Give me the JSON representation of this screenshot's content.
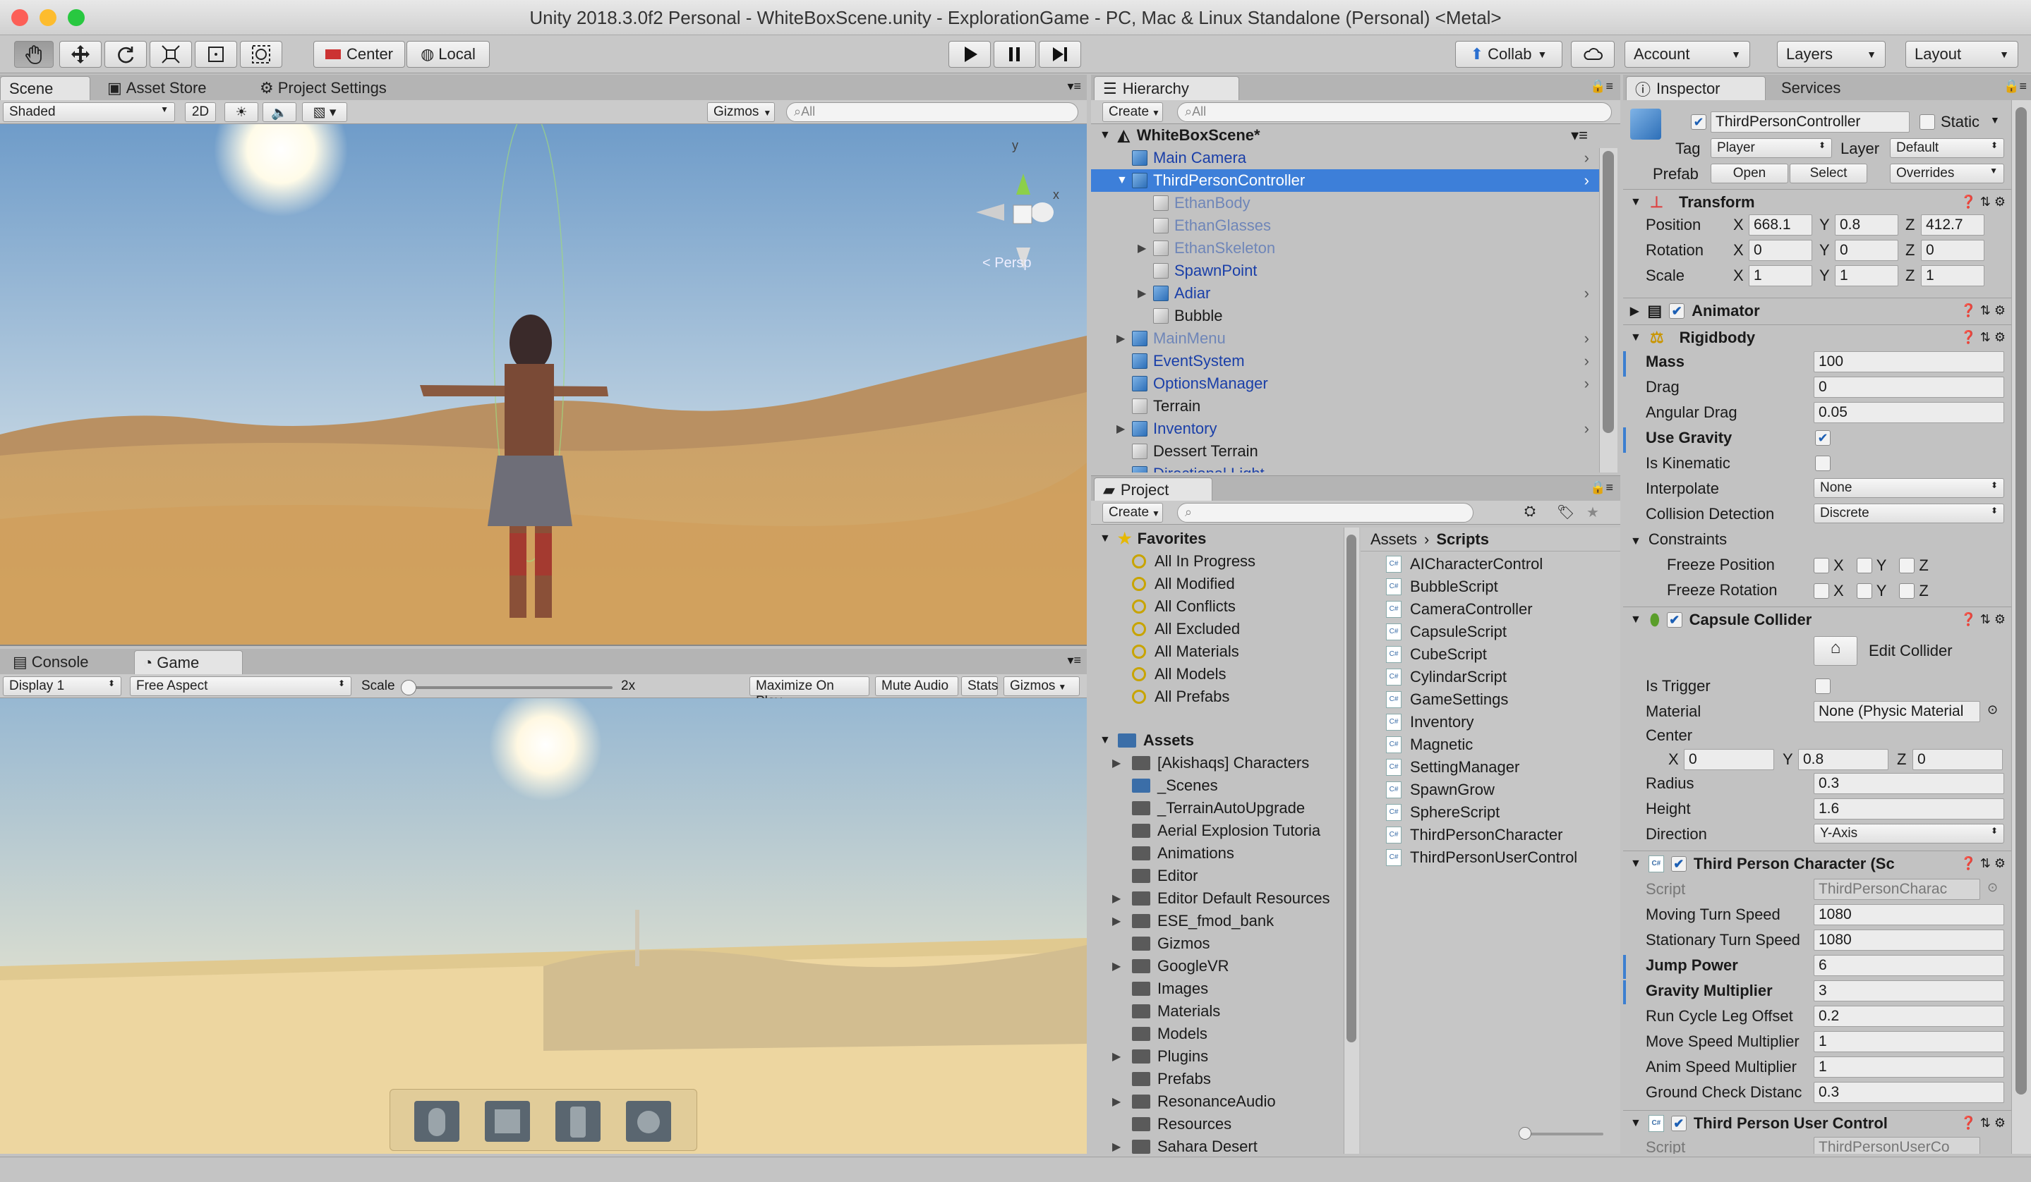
{
  "window": {
    "title": "Unity 2018.3.0f2 Personal - WhiteBoxScene.unity - ExplorationGame - PC, Mac & Linux Standalone (Personal) <Metal>"
  },
  "toolbar": {
    "pivot_center": "Center",
    "pivot_local": "Local",
    "collab": "Collab",
    "account": "Account",
    "layers": "Layers",
    "layout": "Layout"
  },
  "scene_panel": {
    "tabs": [
      "Scene",
      "Asset Store",
      "Project Settings"
    ],
    "shading": "Shaded",
    "mode_2d": "2D",
    "gizmos": "Gizmos",
    "search_placeholder": "All",
    "axis_y": "y",
    "axis_x": "x",
    "persp": "< Persp"
  },
  "game_panel": {
    "tabs": [
      "Console",
      "Game"
    ],
    "display": "Display 1",
    "aspect": "Free Aspect",
    "scale_label": "Scale",
    "scale_value": "2x",
    "buttons": [
      "Maximize On Play",
      "Mute Audio",
      "Stats",
      "Gizmos"
    ]
  },
  "hierarchy": {
    "tab": "Hierarchy",
    "create": "Create",
    "search_placeholder": "All",
    "scene_name": "WhiteBoxScene*",
    "items": [
      {
        "label": "Main Camera",
        "color": "#1a3fa8",
        "depth": 1
      },
      {
        "label": "ThirdPersonController",
        "color": "#ffffff",
        "depth": 1,
        "selected": true
      },
      {
        "label": "EthanBody",
        "color": "#6f86b8",
        "depth": 2
      },
      {
        "label": "EthanGlasses",
        "color": "#6f86b8",
        "depth": 2
      },
      {
        "label": "EthanSkeleton",
        "color": "#6f86b8",
        "depth": 2
      },
      {
        "label": "SpawnPoint",
        "color": "#1a3fa8",
        "depth": 2
      },
      {
        "label": "Adiar",
        "color": "#1a3fa8",
        "depth": 2
      },
      {
        "label": "Bubble",
        "color": "#1a1a1a",
        "depth": 2
      },
      {
        "label": "MainMenu",
        "color": "#6f86b8",
        "depth": 1
      },
      {
        "label": "EventSystem",
        "color": "#1a3fa8",
        "depth": 1
      },
      {
        "label": "OptionsManager",
        "color": "#1a3fa8",
        "depth": 1
      },
      {
        "label": "Terrain",
        "color": "#1a1a1a",
        "depth": 1
      },
      {
        "label": "Inventory",
        "color": "#1a3fa8",
        "depth": 1
      },
      {
        "label": "Dessert Terrain",
        "color": "#1a1a1a",
        "depth": 1
      },
      {
        "label": "Directional Light",
        "color": "#1a3fa8",
        "depth": 1
      }
    ]
  },
  "project": {
    "tab": "Project",
    "create": "Create",
    "favorites_label": "Favorites",
    "favorites": [
      "All In Progress",
      "All Modified",
      "All Conflicts",
      "All Excluded",
      "All Materials",
      "All Models",
      "All Prefabs"
    ],
    "assets_label": "Assets",
    "folders": [
      "[Akishaqs] Characters",
      "_Scenes",
      "_TerrainAutoUpgrade",
      "Aerial Explosion Tutoria",
      "Animations",
      "Editor",
      "Editor Default Resources",
      "ESE_fmod_bank",
      "Gizmos",
      "GoogleVR",
      "Images",
      "Materials",
      "Models",
      "Plugins",
      "Prefabs",
      "ResonanceAudio",
      "Resources",
      "Sahara Desert"
    ],
    "breadcrumb": [
      "Assets",
      "Scripts"
    ],
    "scripts": [
      "AICharacterControl",
      "BubbleScript",
      "CameraController",
      "CapsuleScript",
      "CubeScript",
      "CylindarScript",
      "GameSettings",
      "Inventory",
      "Magnetic",
      "SettingManager",
      "SpawnGrow",
      "SphereScript",
      "ThirdPersonCharacter",
      "ThirdPersonUserControl"
    ]
  },
  "inspector": {
    "tabs": [
      "Inspector",
      "Services"
    ],
    "object_name": "ThirdPersonController",
    "static_label": "Static",
    "tag_label": "Tag",
    "tag_value": "Player",
    "layer_label": "Layer",
    "layer_value": "Default",
    "prefab_label": "Prefab",
    "prefab_open": "Open",
    "prefab_select": "Select",
    "prefab_overrides": "Overrides",
    "transform": {
      "title": "Transform",
      "position_label": "Position",
      "rotation_label": "Rotation",
      "scale_label": "Scale",
      "position": [
        "668.1",
        "0.8",
        "412.7"
      ],
      "rotation": [
        "0",
        "0",
        "0"
      ],
      "scale": [
        "1",
        "1",
        "1"
      ]
    },
    "animator": {
      "title": "Animator"
    },
    "rigidbody": {
      "title": "Rigidbody",
      "mass_label": "Mass",
      "mass": "100",
      "drag_label": "Drag",
      "drag": "0",
      "angular_drag_label": "Angular Drag",
      "angular_drag": "0.05",
      "use_gravity_label": "Use Gravity",
      "is_kinematic_label": "Is Kinematic",
      "interpolate_label": "Interpolate",
      "interpolate": "None",
      "collision_label": "Collision Detection",
      "collision": "Discrete",
      "constraints_label": "Constraints",
      "freeze_position_label": "Freeze Position",
      "freeze_rotation_label": "Freeze Rotation"
    },
    "capsule": {
      "title": "Capsule Collider",
      "edit_collider": "Edit Collider",
      "is_trigger_label": "Is Trigger",
      "material_label": "Material",
      "material": "None (Physic Material",
      "center_label": "Center",
      "center": [
        "0",
        "0.8",
        "0"
      ],
      "radius_label": "Radius",
      "radius": "0.3",
      "height_label": "Height",
      "height": "1.6",
      "direction_label": "Direction",
      "direction": "Y-Axis"
    },
    "tpc": {
      "title": "Third Person Character (Sc",
      "script_label": "Script",
      "script": "ThirdPersonCharac",
      "fields": [
        {
          "label": "Moving Turn Speed",
          "value": "1080",
          "bold": false
        },
        {
          "label": "Stationary Turn Speed",
          "value": "1080",
          "bold": false
        },
        {
          "label": "Jump Power",
          "value": "6",
          "bold": true
        },
        {
          "label": "Gravity Multiplier",
          "value": "3",
          "bold": true
        },
        {
          "label": "Run Cycle Leg Offset",
          "value": "0.2",
          "bold": false
        },
        {
          "label": "Move Speed Multiplier",
          "value": "1",
          "bold": false
        },
        {
          "label": "Anim Speed Multiplier",
          "value": "1",
          "bold": false
        },
        {
          "label": "Ground Check Distanc",
          "value": "0.3",
          "bold": false
        }
      ]
    },
    "tpuc": {
      "title": "Third Person User Control",
      "script_label": "Script",
      "script": "ThirdPersonUserCo"
    }
  },
  "xyz": [
    "X",
    "Y",
    "Z"
  ]
}
